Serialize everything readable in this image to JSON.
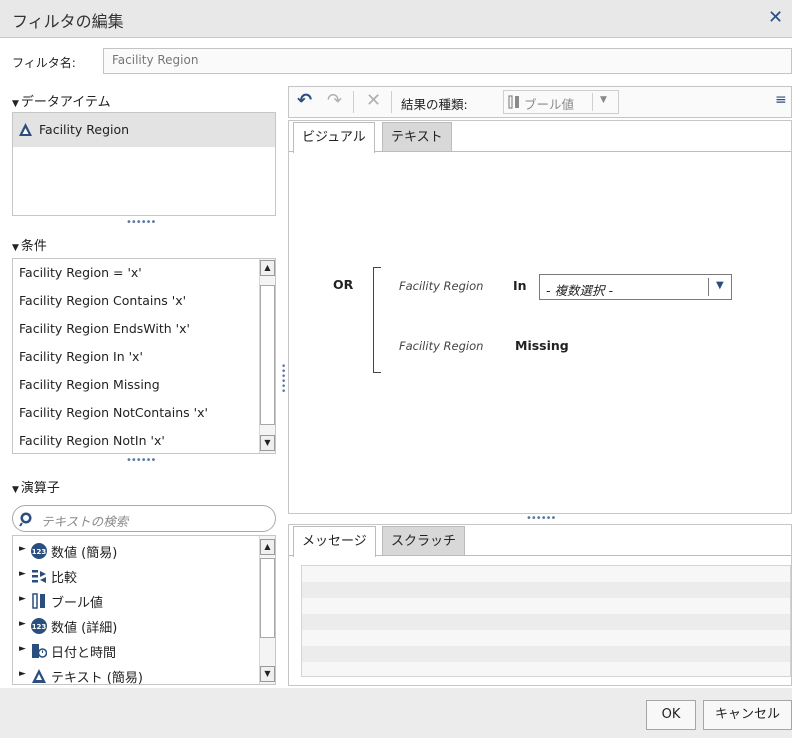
{
  "dialog": {
    "title": "フィルタの編集",
    "close_glyph": "✕"
  },
  "filter_name": {
    "label": "フィルタ名:",
    "value": "Facility Region"
  },
  "data_items": {
    "header": "データアイテム",
    "items": [
      {
        "label": "Facility Region",
        "icon": "category-triangle-icon"
      }
    ]
  },
  "conditions": {
    "header": "条件",
    "items": [
      "Facility Region = 'x'",
      "Facility Region Contains 'x'",
      "Facility Region EndsWith 'x'",
      "Facility Region In 'x'",
      "Facility Region Missing",
      "Facility Region NotContains 'x'",
      "Facility Region NotIn 'x'"
    ]
  },
  "operators": {
    "header": "演算子",
    "search_placeholder": "テキストの検索",
    "items": [
      {
        "label": "数値 (簡易)",
        "icon": "numeric-123-icon"
      },
      {
        "label": "比較",
        "icon": "compare-icon"
      },
      {
        "label": "ブール値",
        "icon": "boolean-icon"
      },
      {
        "label": "数値 (詳細)",
        "icon": "numeric-123-icon"
      },
      {
        "label": "日付と時間",
        "icon": "calendar-icon"
      },
      {
        "label": "テキスト (簡易)",
        "icon": "text-triangle-icon"
      }
    ]
  },
  "toolbar": {
    "result_type_label": "結果の種類:",
    "result_type_value": "ブール値"
  },
  "editor": {
    "tabs": [
      "ビジュアル",
      "テキスト"
    ],
    "operator": "OR",
    "row1": {
      "field": "Facility Region",
      "op": "In",
      "value": "- 複数選択 -"
    },
    "row2": {
      "field": "Facility Region",
      "op": "Missing"
    }
  },
  "messages": {
    "tabs": [
      "メッセージ",
      "スクラッチ"
    ]
  },
  "footer": {
    "ok_label": "OK",
    "cancel_label": "キャンセル"
  },
  "colors": {
    "accent": "#2a4f7f",
    "selected_bg": "#e3e3e3"
  }
}
